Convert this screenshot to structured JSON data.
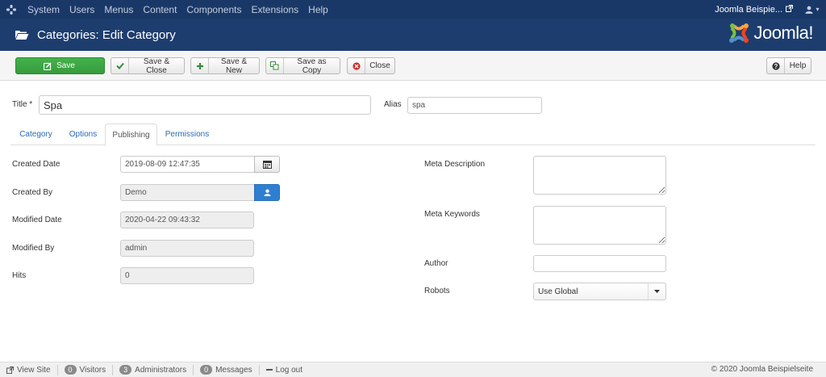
{
  "topnav": {
    "menu": [
      "System",
      "Users",
      "Menus",
      "Content",
      "Components",
      "Extensions",
      "Help"
    ],
    "site_name": "Joomla Beispie...",
    "user_caret": "▾"
  },
  "header": {
    "title": "Categories: Edit Category",
    "brand": "Joomla!"
  },
  "toolbar": {
    "save": "Save",
    "save_close": "Save & Close",
    "save_new": "Save & New",
    "save_copy": "Save as Copy",
    "close": "Close",
    "help": "Help"
  },
  "form": {
    "title_label": "Title *",
    "title_value": "Spa",
    "alias_label": "Alias",
    "alias_value": "spa"
  },
  "tabs": [
    "Category",
    "Options",
    "Publishing",
    "Permissions"
  ],
  "publishing": {
    "created_date_label": "Created Date",
    "created_date": "2019-08-09 12:47:35",
    "created_by_label": "Created By",
    "created_by": "Demo",
    "modified_date_label": "Modified Date",
    "modified_date": "2020-04-22 09:43:32",
    "modified_by_label": "Modified By",
    "modified_by": "admin",
    "hits_label": "Hits",
    "hits": "0"
  },
  "meta": {
    "description_label": "Meta Description",
    "keywords_label": "Meta Keywords",
    "author_label": "Author",
    "robots_label": "Robots",
    "robots_value": "Use Global"
  },
  "footer": {
    "view_site": "View Site",
    "visitors_count": "0",
    "visitors": "Visitors",
    "admins_count": "3",
    "admins": "Administrators",
    "messages_count": "0",
    "messages": "Messages",
    "logout": "Log out",
    "copyright": "© 2020 Joomla Beispielseite"
  },
  "colors": {
    "topbar": "#1a3867",
    "header": "#1c3d6e",
    "save_green": "#3ca243",
    "link_blue": "#2a69b8"
  }
}
